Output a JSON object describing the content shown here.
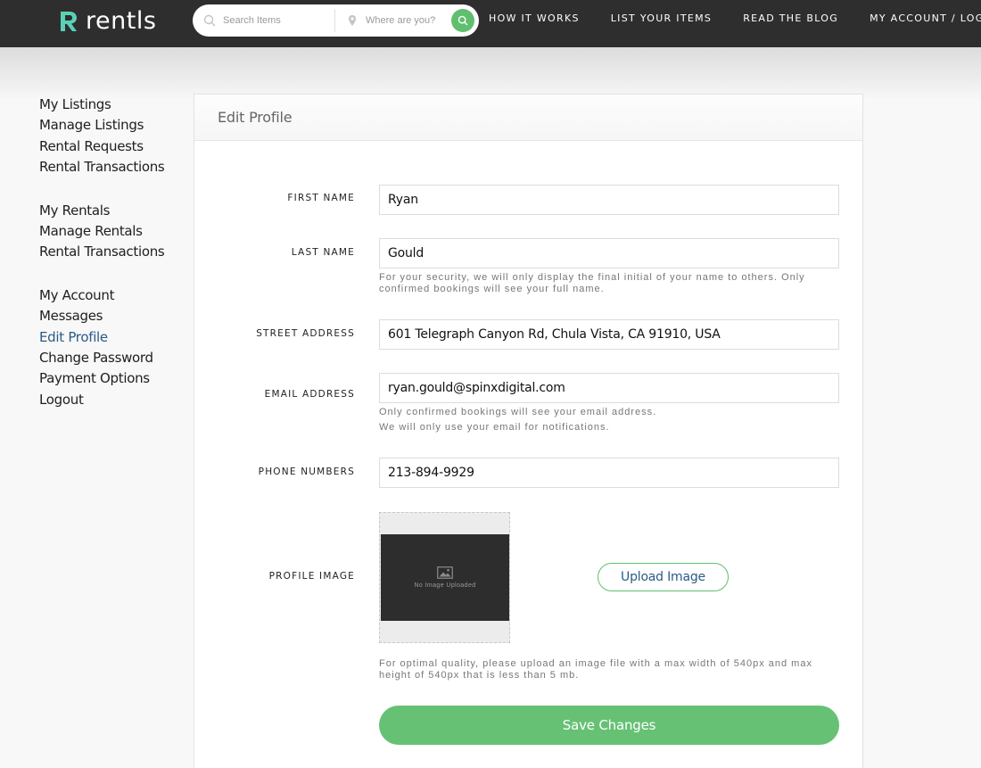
{
  "header": {
    "logo_text": "rentls",
    "search": {
      "items_placeholder": "Search Items",
      "where_placeholder": "Where are you?"
    },
    "nav": [
      {
        "label": "How it works"
      },
      {
        "label": "List your items"
      },
      {
        "label": "Read the blog"
      },
      {
        "label": "My account / Logout"
      }
    ]
  },
  "sidebar": {
    "groups": [
      {
        "items": [
          {
            "label": "My Listings"
          },
          {
            "label": "Manage Listings"
          },
          {
            "label": "Rental Requests"
          },
          {
            "label": "Rental Transactions"
          }
        ]
      },
      {
        "items": [
          {
            "label": "My Rentals"
          },
          {
            "label": "Manage Rentals"
          },
          {
            "label": "Rental Transactions"
          }
        ]
      },
      {
        "items": [
          {
            "label": "My Account"
          },
          {
            "label": "Messages"
          },
          {
            "label": "Edit Profile"
          },
          {
            "label": "Change Password"
          },
          {
            "label": "Payment Options"
          },
          {
            "label": "Logout"
          }
        ]
      }
    ],
    "active_item": "Edit Profile"
  },
  "panel": {
    "title": "Edit Profile",
    "first_name": {
      "label": "First Name",
      "value": "Ryan"
    },
    "last_name": {
      "label": "Last Name",
      "value": "Gould",
      "hint": "For your security, we will only display the final initial of your name to others. Only confirmed bookings will see your full name."
    },
    "street_address": {
      "label": "Street Address",
      "value": "601 Telegraph Canyon Rd, Chula Vista, CA 91910, USA"
    },
    "email": {
      "label": "Email Address",
      "value": "ryan.gould@spinxdigital.com",
      "hint_1": "Only confirmed bookings will see your email address.",
      "hint_2": "We will only use your email for notifications."
    },
    "phone": {
      "label": "Phone Numbers",
      "value": "213-894-9929"
    },
    "profile_image": {
      "label": "Profile Image",
      "placeholder_text": "No Image Uploaded",
      "upload_label": "Upload Image",
      "hint": "For optimal quality, please upload an image file with a max width of 540px and max height of 540px that is less than 5 mb."
    },
    "save_label": "Save Changes"
  },
  "colors": {
    "accent_green": "#66c174",
    "link_blue": "#2c5a88",
    "header_bg": "#2e2e2e",
    "logo_teal": "#5ad0b5"
  }
}
